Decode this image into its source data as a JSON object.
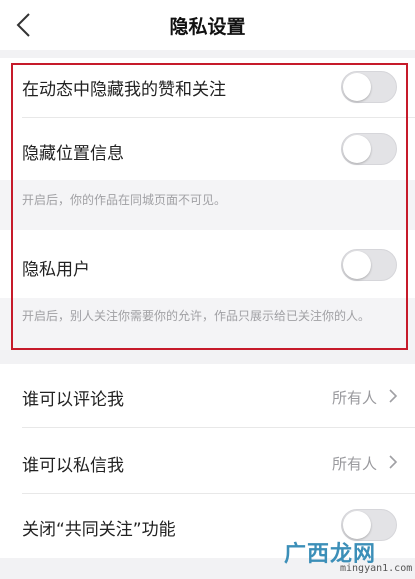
{
  "header": {
    "title": "隐私设置",
    "back_icon": "chevron-left-icon"
  },
  "settings": [
    {
      "label": "在动态中隐藏我的赞和关注",
      "enabled": false
    },
    {
      "label": "隐藏位置信息",
      "enabled": false,
      "hint": "开启后，你的作品在同城页面不可见。"
    },
    {
      "label": "隐私用户",
      "enabled": false,
      "hint": "开启后，别人关注你需要你的允许，作品只展示给已关注你的人。"
    }
  ],
  "permissions": [
    {
      "label": "谁可以评论我",
      "value": "所有人"
    },
    {
      "label": "谁可以私信我",
      "value": "所有人"
    }
  ],
  "mutual_follow": {
    "label": "关闭“共同关注”功能",
    "enabled": false
  },
  "watermark": {
    "logo": "广西龙网",
    "url": "mingyan1.com"
  },
  "colors": {
    "highlight_border": "#c61a2a",
    "toggle_off": "#e3e3e6",
    "secondary_text": "#9a9a9e"
  }
}
